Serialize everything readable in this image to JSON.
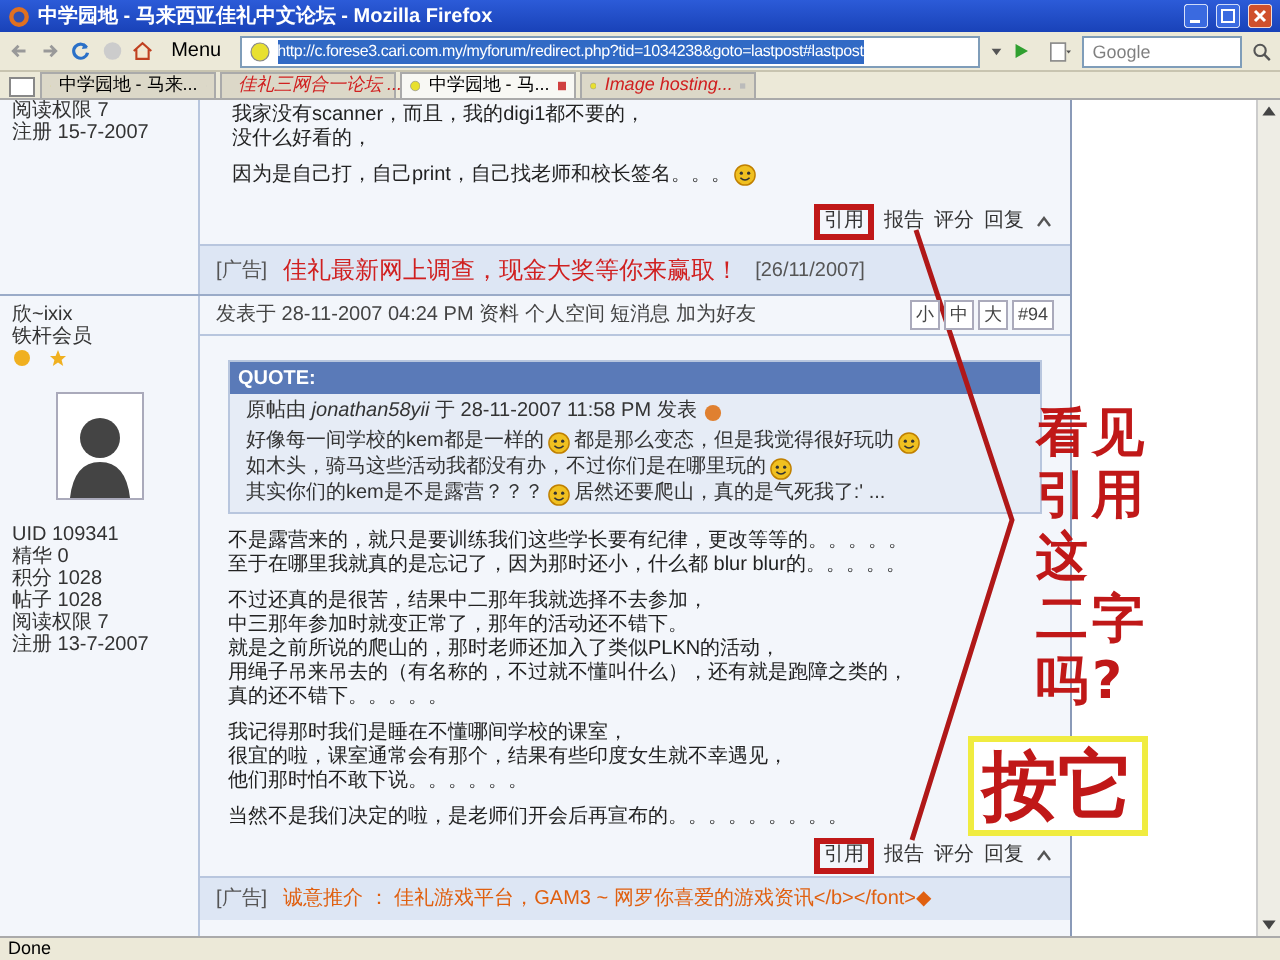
{
  "window": {
    "title": "中学园地 - 马来西亚佳礼中文论坛 - Mozilla Firefox"
  },
  "toolbar": {
    "menu_label": "Menu",
    "url": "http://c.forese3.cari.com.my/myforum/redirect.php?tid=1034238&goto=lastpost#lastpost",
    "search": {
      "placeholder": "Google"
    }
  },
  "tabs": [
    {
      "label": "中学园地 - 马来...",
      "selected": false,
      "kind": "normal"
    },
    {
      "label": "佳礼三网合一论坛 ...",
      "selected": false,
      "kind": "highlighted"
    },
    {
      "label": "中学园地 - 马...",
      "selected": true,
      "kind": "normal"
    },
    {
      "label": "Image hosting...",
      "selected": false,
      "kind": "highlighted"
    }
  ],
  "posts": [
    {
      "author": {
        "info": [
          "阅读权限 7",
          "注册 15-7-2007"
        ]
      },
      "body": [
        {
          "lines": [
            "我家没有scanner，而且，我的digi1都不要的，",
            "没什么好看的，"
          ],
          "smiley": false
        },
        {
          "lines": [
            "因为是自己打，自己print，自己找老师和校长签名。。。"
          ],
          "smiley": true
        }
      ],
      "actions": [
        {
          "label": "引用",
          "highlighted": true
        },
        {
          "label": "报告",
          "highlighted": false
        },
        {
          "label": "评分",
          "highlighted": false
        },
        {
          "label": "回复",
          "highlighted": false
        }
      ],
      "ad": {
        "tag": "[广告]",
        "text": "佳礼最新网上调查，现金大奖等你来赢取！",
        "date": "[26/11/2007]"
      }
    },
    {
      "author": {
        "name": "欣~ixix",
        "rank": "铁杆会员",
        "info": [
          "UID 109341",
          "精华 0",
          "积分 1028",
          "帖子 1028",
          "阅读权限 7",
          "注册 13-7-2007"
        ]
      },
      "header": {
        "meta": "发表于 28-11-2007 04:24 PM 资料 个人空间 短消息 加为好友",
        "sizes": [
          "小",
          "中",
          "大"
        ],
        "number": "#94"
      },
      "quote": {
        "title": "QUOTE:",
        "source": "原帖由 *jonathan58yii* 于 28-11-2007 11:58 PM 发表",
        "lines": [
          [
            {
              "kind": "text",
              "text": "好像每一间学校的kem都是一样的"
            },
            {
              "kind": "smiley"
            },
            {
              "kind": "text",
              "text": "都是那么变态，但是我觉得很好玩叻"
            },
            {
              "kind": "smiley"
            }
          ],
          [
            {
              "kind": "text",
              "text": "如木头，骑马这些活动我都没有办，不过你们是在哪里玩的"
            },
            {
              "kind": "smiley"
            }
          ],
          [
            {
              "kind": "text",
              "text": "其实你们的kem是不是露营？？？"
            },
            {
              "kind": "smiley"
            },
            {
              "kind": "text",
              "text": "居然还要爬山，真的是气死我了:' ..."
            }
          ]
        ]
      },
      "body": [
        {
          "lines": [
            "不是露营来的，就只是要训练我们这些学长要有纪律，更改等等的。。。。。",
            "至于在哪里我就真的是忘记了，因为那时还小，什么都 blur blur的。。。。。"
          ],
          "smiley": false
        },
        {
          "lines": [
            "不过还真的是很苦，结果中二那年我就选择不去参加，",
            "中三那年参加时就变正常了，那年的活动还不错下。",
            "就是之前所说的爬山的，那时老师还加入了类似PLKN的活动，",
            "用绳子吊来吊去的（有名称的，不过就不懂叫什么），还有就是跑障之类的，",
            "真的还不错下。。。。。"
          ],
          "smiley": false
        },
        {
          "lines": [
            "我记得那时我们是睡在不懂哪间学校的课室，",
            "很宜的啦，课室通常会有那个，结果有些印度女生就不幸遇见，",
            "他们那时怕不敢下说。。。。。。"
          ],
          "smiley": false
        },
        {
          "lines": [
            "当然不是我们决定的啦，是老师们开会后再宣布的。。。。。。。。。"
          ],
          "smiley": false
        }
      ],
      "actions": [
        {
          "label": "引用",
          "highlighted": true
        },
        {
          "label": "报告",
          "highlighted": false
        },
        {
          "label": "评分",
          "highlighted": false
        },
        {
          "label": "回复",
          "highlighted": false
        }
      ],
      "ad": {
        "tag": "[广告]",
        "text": "诚意推介 ： 佳礼游戏平台，GAM3 ~ 网罗你喜爱的游戏资讯</b></font>◆"
      }
    }
  ],
  "annotation": {
    "question_lines": [
      "看见",
      "引用",
      "这",
      "二字",
      "吗?"
    ],
    "instruction": "按它"
  },
  "status_bar": "Done"
}
